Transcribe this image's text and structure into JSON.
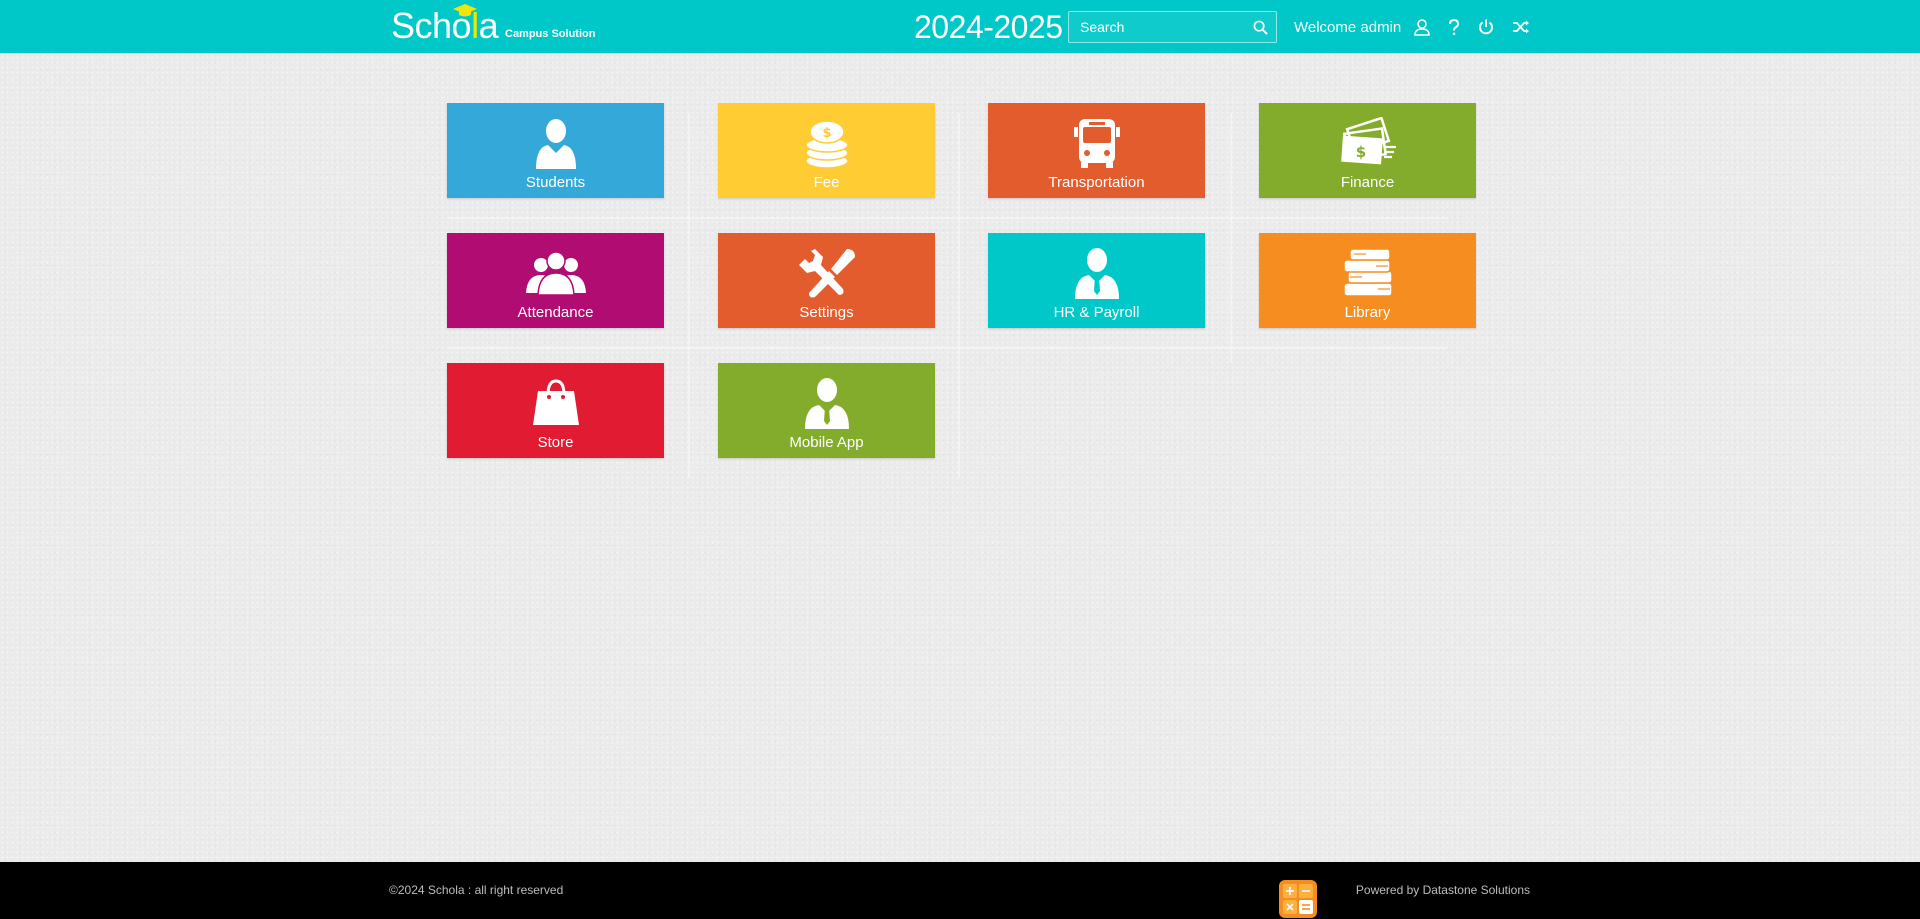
{
  "header": {
    "logo_text_start": "Scho",
    "logo_text_highlight": "l",
    "logo_text_end": "a",
    "logo_subtitle": "Campus Solution",
    "academic_year": "2024-2025",
    "search_placeholder": "Search",
    "welcome_text": "Welcome admin",
    "icons": [
      "profile-icon",
      "help-icon",
      "power-icon",
      "shuffle-icon"
    ]
  },
  "tiles": [
    {
      "label": "Students",
      "icon": "student-icon",
      "color": "#35a8da"
    },
    {
      "label": "Fee",
      "icon": "coins-icon",
      "color": "#ffcc33"
    },
    {
      "label": "Transportation",
      "icon": "bus-icon",
      "color": "#e35c2e"
    },
    {
      "label": "Finance",
      "icon": "money-icon",
      "color": "#84ac2c"
    },
    {
      "label": "Attendance",
      "icon": "group-icon",
      "color": "#b00c72"
    },
    {
      "label": "Settings",
      "icon": "tools-icon",
      "color": "#e35c2e"
    },
    {
      "label": "HR & Payroll",
      "icon": "employee-icon",
      "color": "#00c8c8"
    },
    {
      "label": "Library",
      "icon": "books-icon",
      "color": "#f68d20"
    },
    {
      "label": "Store",
      "icon": "shopping-bag-icon",
      "color": "#e11b32"
    },
    {
      "label": "Mobile App",
      "icon": "businessman-icon",
      "color": "#84ac2c"
    }
  ],
  "footer": {
    "copyright": "©2024 Schola : all right reserved",
    "powered_by": "Powered by Datastone Solutions",
    "calculator_icon": "calculator-icon"
  },
  "colors": {
    "header_bg": "#00c8c8",
    "footer_bg": "#000000",
    "page_bg": "#ebebeb",
    "logo_accent": "#f2e600"
  }
}
